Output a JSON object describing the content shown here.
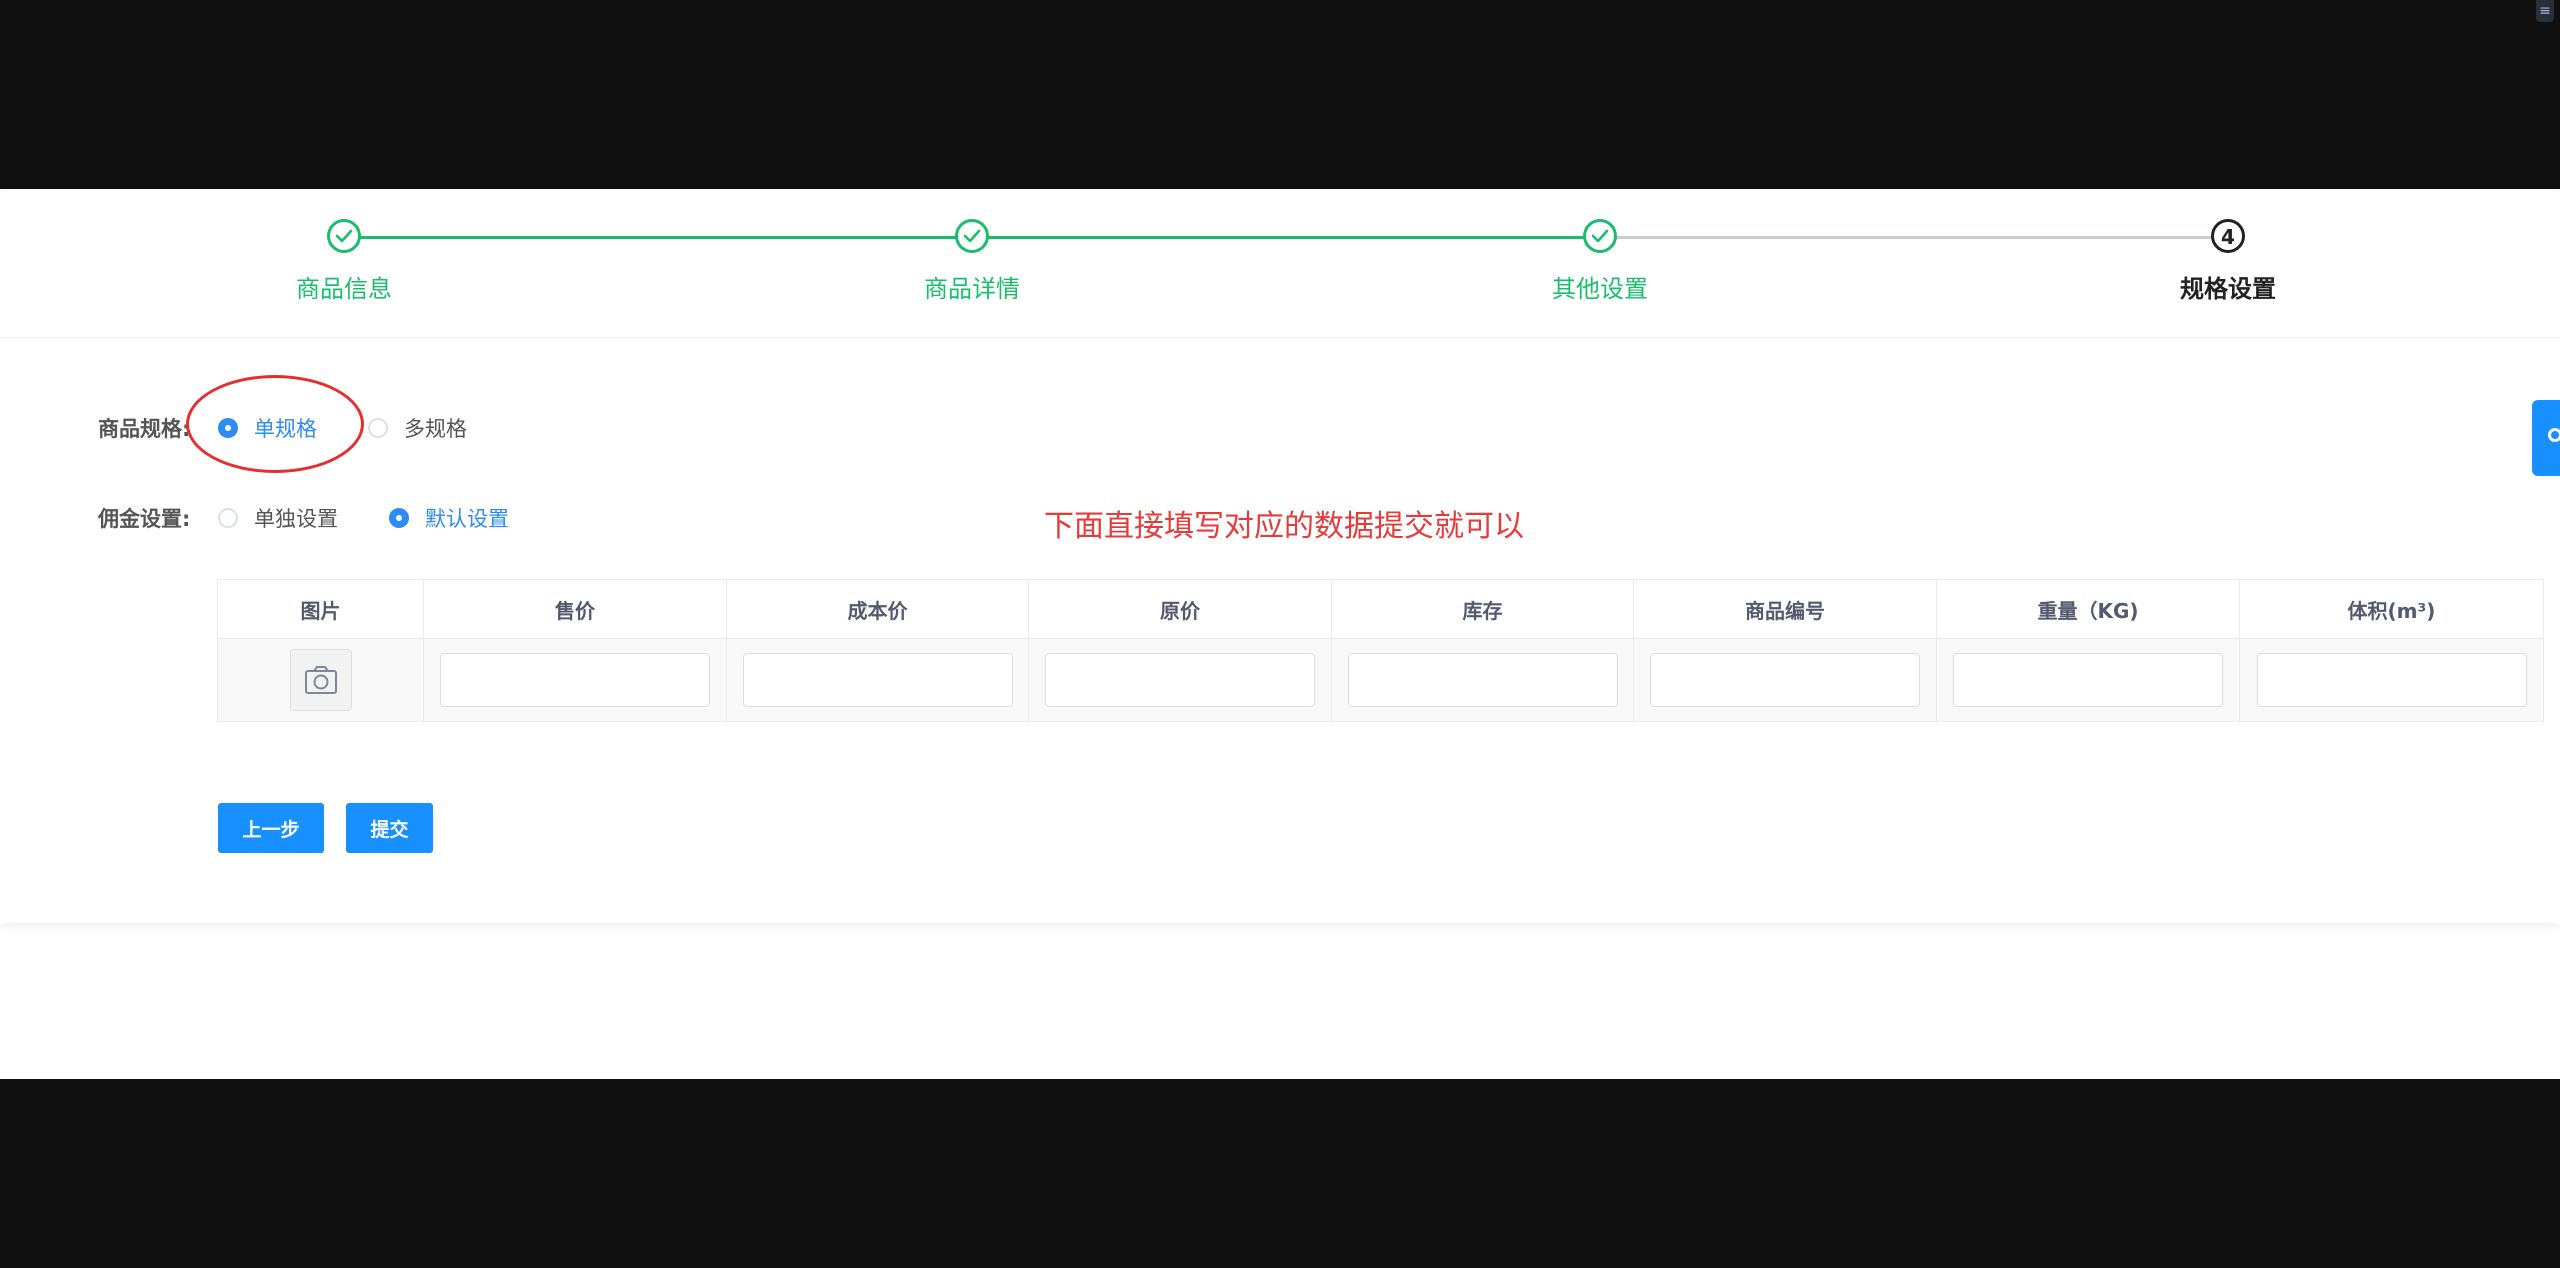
{
  "steps": [
    {
      "label": "商品信息",
      "status": "done"
    },
    {
      "label": "商品详情",
      "status": "done"
    },
    {
      "label": "其他设置",
      "status": "done"
    },
    {
      "label": "规格设置",
      "status": "current",
      "number": "4"
    }
  ],
  "form": {
    "spec_label": "商品规格:",
    "spec_options": [
      "单规格",
      "多规格"
    ],
    "spec_selected": "单规格",
    "commission_label": "佣金设置:",
    "commission_options": [
      "单独设置",
      "默认设置"
    ],
    "commission_selected": "默认设置"
  },
  "annotation": {
    "note": "下面直接填写对应的数据提交就可以"
  },
  "table": {
    "columns": [
      "图片",
      "售价",
      "成本价",
      "原价",
      "库存",
      "商品编号",
      "重量（KG)",
      "体积(m³)"
    ]
  },
  "buttons": {
    "prev": "上一步",
    "submit": "提交"
  },
  "colors": {
    "step_done": "#19be6b",
    "primary": "#1890ff",
    "annotation": "#e62e2e"
  }
}
